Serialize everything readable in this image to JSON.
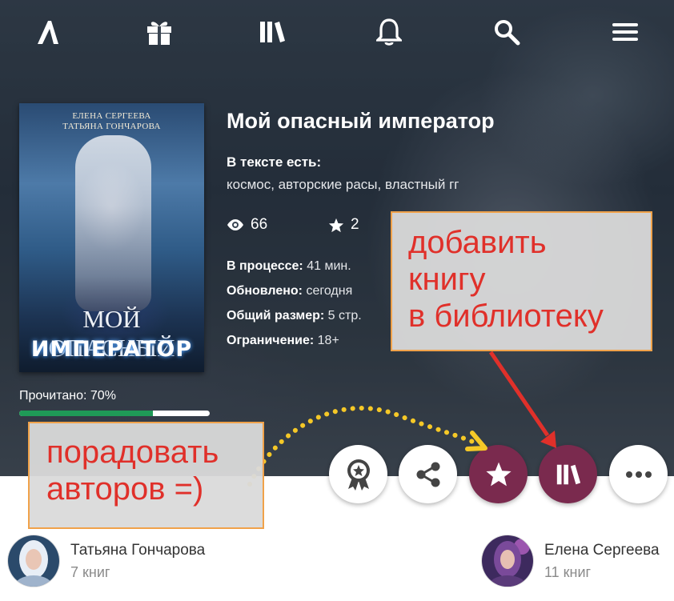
{
  "book": {
    "title": "Мой опасный император",
    "tags_label": "В тексте есть:",
    "tags": "космос, авторские расы, властный гг",
    "views": "66",
    "stars": "2",
    "cover": {
      "authors_line1": "ЕЛЕНА СЕРГЕЕВА",
      "authors_line2": "ТАТЬЯНА ГОНЧАРОВА",
      "title_line1": "МОЙ ОПАСНЫЙ",
      "title_line2": "ИМПЕРАТОР"
    },
    "meta": [
      {
        "label": "В процессе:",
        "value": "41 мин."
      },
      {
        "label": "Обновлено:",
        "value": "сегодня"
      },
      {
        "label": "Общий размер:",
        "value": "5 стр."
      },
      {
        "label": "Ограничение:",
        "value": "18+"
      }
    ],
    "progress": {
      "label": "Прочитано: 70%",
      "fraction": 0.7
    }
  },
  "nav": {
    "icons": [
      "logo-icon",
      "gift-icon",
      "library-icon",
      "bell-icon",
      "search-icon",
      "menu-icon"
    ]
  },
  "actions": [
    "award-icon",
    "share-icon",
    "star-icon",
    "library-icon",
    "more-icon"
  ],
  "authors": [
    {
      "name": "Татьяна Гончарова",
      "count": "7 книг"
    },
    {
      "name": "Елена Сергеева",
      "count": "11 книг"
    }
  ],
  "callouts": {
    "library_lines": [
      "добавить",
      "книгу",
      "в библиотеку"
    ],
    "authors_lines": [
      "порадовать",
      "авторов =)"
    ]
  },
  "colors": {
    "accent": "#7a2a4e",
    "progress": "#1f9a57",
    "callout_text": "#e0302a",
    "callout_border": "#f0a24a",
    "arrow": "#e0302a",
    "dots": "#f5c827"
  }
}
